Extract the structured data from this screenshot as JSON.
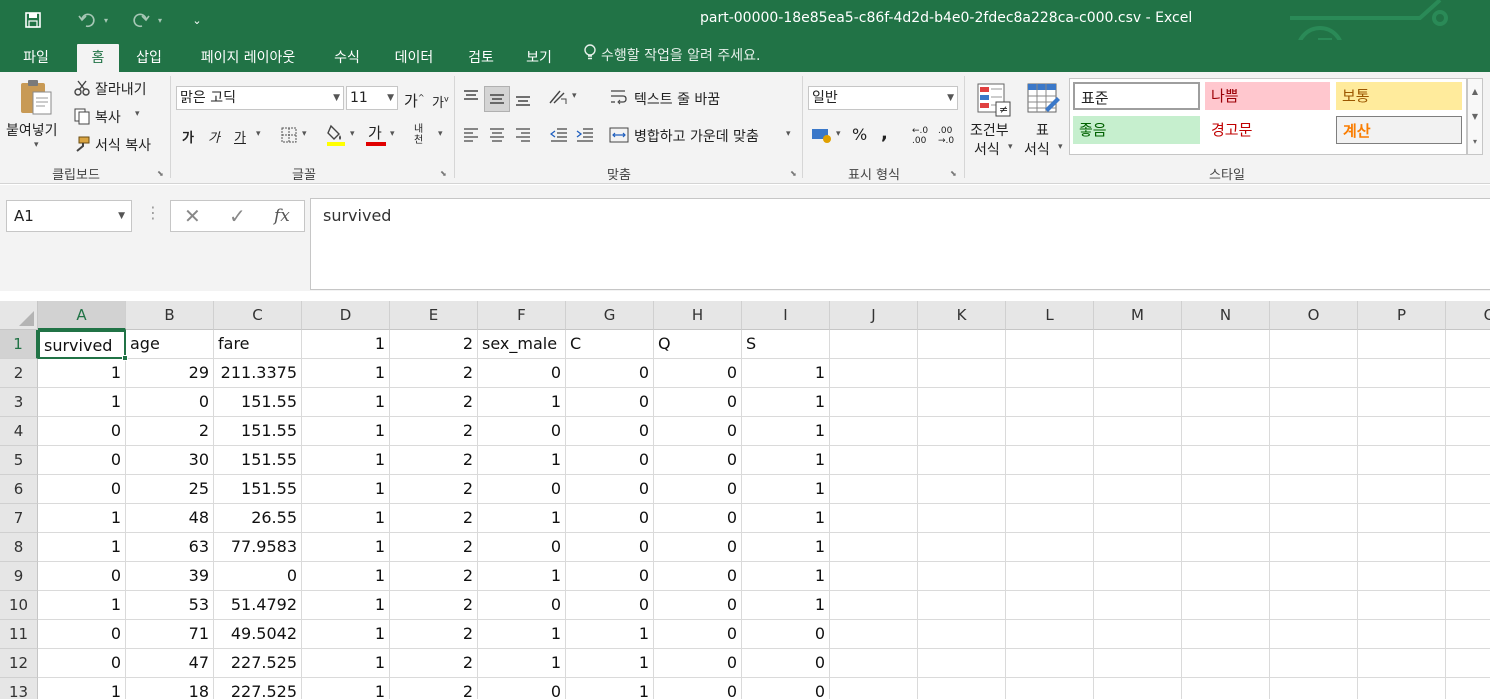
{
  "window": {
    "title": "part-00000-18e85ea5-c86f-4d2d-b4e0-2fdec8a228ca-c000.csv  -  Excel"
  },
  "ribbon_tabs": [
    {
      "label": "파일"
    },
    {
      "label": "홈"
    },
    {
      "label": "삽입"
    },
    {
      "label": "페이지 레이아웃"
    },
    {
      "label": "수식"
    },
    {
      "label": "데이터"
    },
    {
      "label": "검토"
    },
    {
      "label": "보기"
    }
  ],
  "tell_me": "수행할 작업을 알려 주세요.",
  "clipboard": {
    "paste": "붙여넣기",
    "cut": "잘라내기",
    "copy": "복사",
    "format_painter": "서식 복사",
    "group_label": "클립보드"
  },
  "font": {
    "font_name": "맑은 고딕",
    "font_size": "11",
    "grow_glyph": "가",
    "shrink_glyph": "가",
    "bold_glyph": "가",
    "italic_glyph": "가",
    "underline_glyph": "가",
    "font_color_glyph": "가",
    "phonetic_glyph": "내천",
    "group_label": "글꼴"
  },
  "alignment": {
    "wrap_text": "텍스트 줄 바꿈",
    "merge_center": "병합하고 가운데 맞춤",
    "group_label": "맞춤"
  },
  "number": {
    "format": "일반",
    "percent": "%",
    "comma": ",",
    "increase_decimal": "←.0 .00",
    "decrease_decimal": ".00 →.0",
    "group_label": "표시 형식"
  },
  "styles": {
    "conditional_line1": "조건부",
    "conditional_line2": "서식",
    "table_line1": "표",
    "table_line2": "서식",
    "normal": "표준",
    "bad": "나쁨",
    "neutral": "보통",
    "good": "좋음",
    "explanatory": "경고문",
    "calculation": "계산",
    "group_label": "스타일"
  },
  "formula_bar": {
    "name_box": "A1",
    "fx": "fx",
    "formula": "survived"
  },
  "colors": {
    "excel_green": "#217346",
    "bad_bg": "#ffc7ce",
    "bad_fg": "#9c0006",
    "neutral_bg": "#ffeb9c",
    "neutral_fg": "#9c5700",
    "good_bg": "#c6efce",
    "good_fg": "#006100",
    "explanatory_fg": "#c00000",
    "calc_fg": "#fa7d00",
    "calc_bg": "#f2f2f2"
  },
  "grid": {
    "columns": [
      "A",
      "B",
      "C",
      "D",
      "E",
      "F",
      "G",
      "H",
      "I",
      "J",
      "K",
      "L",
      "M",
      "N",
      "O",
      "P",
      "Q"
    ],
    "row_numbers": [
      "1",
      "2",
      "3",
      "4",
      "5",
      "6",
      "7",
      "8",
      "9",
      "10",
      "11",
      "12",
      "13"
    ],
    "rows": [
      [
        "survived",
        "age",
        "fare",
        "1",
        "2",
        "sex_male",
        "C",
        "Q",
        "S"
      ],
      [
        "1",
        "29",
        "211.3375",
        "1",
        "2",
        "0",
        "0",
        "0",
        "1"
      ],
      [
        "1",
        "0",
        "151.55",
        "1",
        "2",
        "1",
        "0",
        "0",
        "1"
      ],
      [
        "0",
        "2",
        "151.55",
        "1",
        "2",
        "0",
        "0",
        "0",
        "1"
      ],
      [
        "0",
        "30",
        "151.55",
        "1",
        "2",
        "1",
        "0",
        "0",
        "1"
      ],
      [
        "0",
        "25",
        "151.55",
        "1",
        "2",
        "0",
        "0",
        "0",
        "1"
      ],
      [
        "1",
        "48",
        "26.55",
        "1",
        "2",
        "1",
        "0",
        "0",
        "1"
      ],
      [
        "1",
        "63",
        "77.9583",
        "1",
        "2",
        "0",
        "0",
        "0",
        "1"
      ],
      [
        "0",
        "39",
        "0",
        "1",
        "2",
        "1",
        "0",
        "0",
        "1"
      ],
      [
        "1",
        "53",
        "51.4792",
        "1",
        "2",
        "0",
        "0",
        "0",
        "1"
      ],
      [
        "0",
        "71",
        "49.5042",
        "1",
        "2",
        "1",
        "1",
        "0",
        "0"
      ],
      [
        "0",
        "47",
        "227.525",
        "1",
        "2",
        "1",
        "1",
        "0",
        "0"
      ],
      [
        "1",
        "18",
        "227.525",
        "1",
        "2",
        "0",
        "1",
        "0",
        "0"
      ]
    ]
  }
}
